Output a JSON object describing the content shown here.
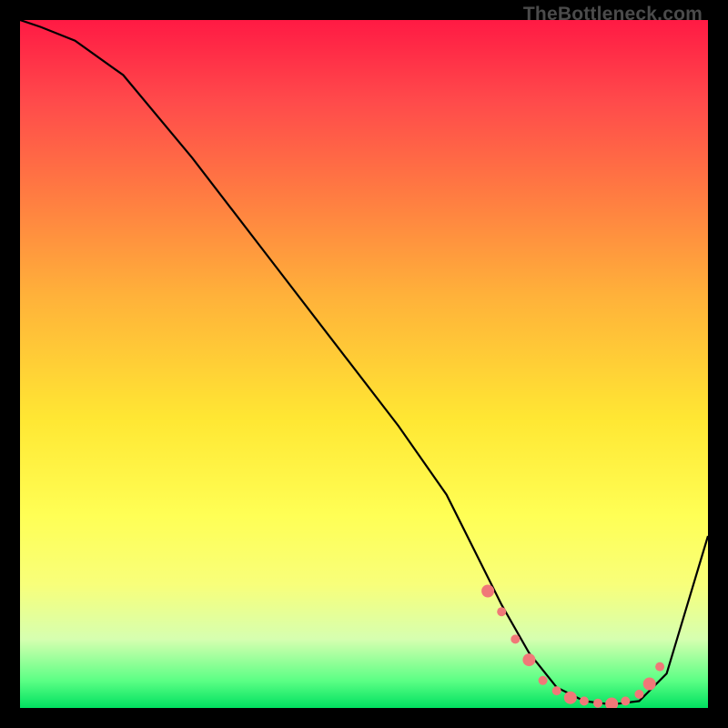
{
  "watermark": "TheBottleneck.com",
  "chart_data": {
    "type": "line",
    "title": "",
    "xlabel": "",
    "ylabel": "",
    "xlim": [
      0,
      100
    ],
    "ylim": [
      0,
      100
    ],
    "series": [
      {
        "name": "bottleneck-curve",
        "x": [
          0,
          3,
          8,
          15,
          25,
          35,
          45,
          55,
          62,
          66,
          70,
          74,
          78,
          82,
          86,
          90,
          94,
          100
        ],
        "y": [
          100,
          99,
          97,
          92,
          80,
          67,
          54,
          41,
          31,
          23,
          15,
          8,
          3,
          1,
          0.5,
          1,
          5,
          25
        ],
        "color": "#000000"
      }
    ],
    "markers": {
      "name": "highlight-band",
      "color": "#f07878",
      "points": [
        {
          "x": 68,
          "y": 17
        },
        {
          "x": 70,
          "y": 14
        },
        {
          "x": 72,
          "y": 10
        },
        {
          "x": 74,
          "y": 7
        },
        {
          "x": 76,
          "y": 4
        },
        {
          "x": 78,
          "y": 2.5
        },
        {
          "x": 80,
          "y": 1.5
        },
        {
          "x": 82,
          "y": 1
        },
        {
          "x": 84,
          "y": 0.7
        },
        {
          "x": 86,
          "y": 0.6
        },
        {
          "x": 88,
          "y": 1
        },
        {
          "x": 90,
          "y": 2
        },
        {
          "x": 91.5,
          "y": 3.5
        },
        {
          "x": 93,
          "y": 6
        }
      ]
    },
    "gradient_stops": [
      {
        "pos": 0,
        "color": "#ff1a44"
      },
      {
        "pos": 12,
        "color": "#ff4b4b"
      },
      {
        "pos": 25,
        "color": "#ff7a42"
      },
      {
        "pos": 40,
        "color": "#ffb13a"
      },
      {
        "pos": 58,
        "color": "#ffe733"
      },
      {
        "pos": 72,
        "color": "#ffff55"
      },
      {
        "pos": 82,
        "color": "#f8ff7a"
      },
      {
        "pos": 90,
        "color": "#d6ffb0"
      },
      {
        "pos": 96,
        "color": "#5cff85"
      },
      {
        "pos": 100,
        "color": "#00e060"
      }
    ]
  }
}
